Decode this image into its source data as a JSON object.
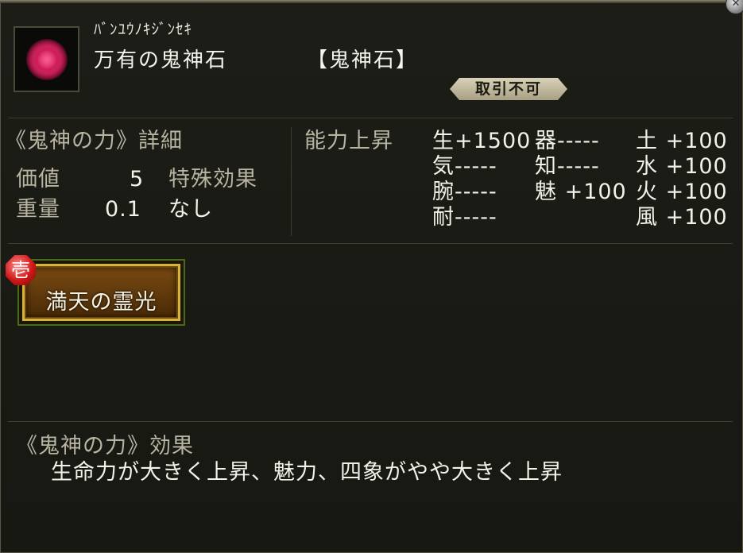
{
  "item": {
    "reading": "ﾊﾞﾝﾕｳﾉｷｼﾞﾝｾｷ",
    "name": "万有の鬼神石",
    "category": "【鬼神石】",
    "trade_status": "取引不可"
  },
  "details": {
    "heading": "《鬼神の力》詳細",
    "value_label": "価値",
    "value": "5",
    "weight_label": "重量",
    "weight": "0.1",
    "special_label": "特殊効果",
    "special_value": "なし"
  },
  "stats": {
    "heading": "能力上昇",
    "rows": [
      [
        "生+1500",
        "器-----",
        "土 +100"
      ],
      [
        "気-----",
        "知-----",
        "水 +100"
      ],
      [
        "腕-----",
        "魅 +100",
        "火 +100"
      ],
      [
        "耐-----",
        "",
        "風 +100"
      ]
    ]
  },
  "skill": {
    "rank": "壱",
    "label": "満天の霊光"
  },
  "effect": {
    "heading": "《鬼神の力》効果",
    "text": "生命力が大きく上昇、魅力、四象がやや大きく上昇"
  },
  "icons": {
    "close": "close-icon",
    "item": "gem-icon"
  },
  "colors": {
    "background": "#191914",
    "text": "#f2f2ea",
    "muted_text": "#b8b4a2",
    "skill_frame": "#d9b23a",
    "rank_badge": "#d01818"
  }
}
